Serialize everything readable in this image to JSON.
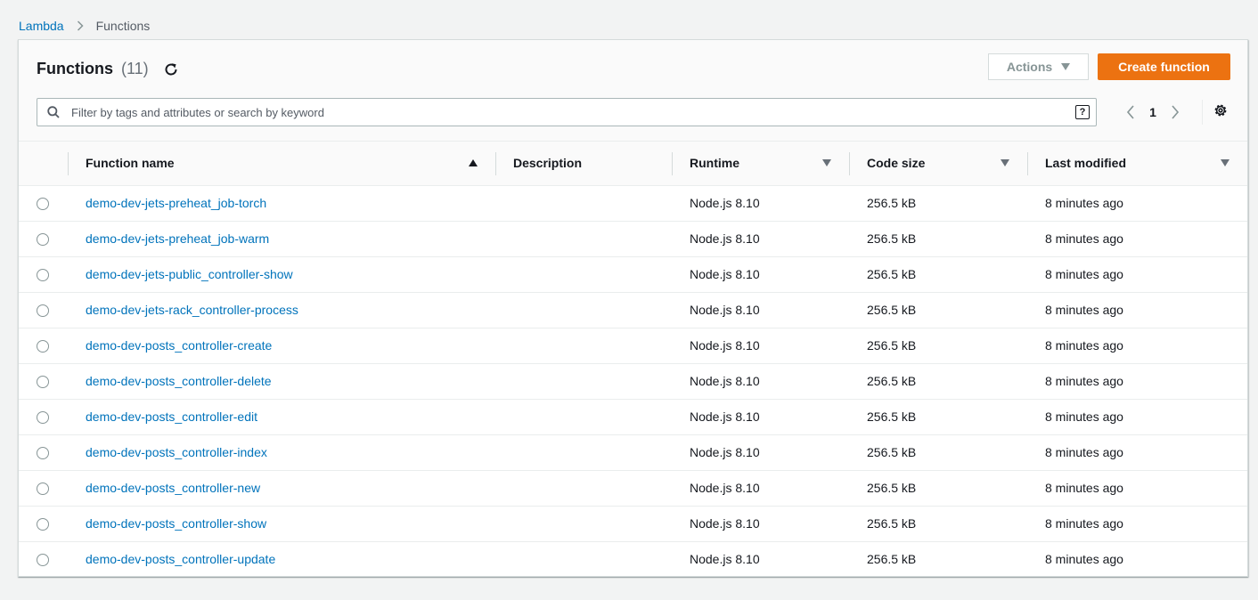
{
  "breadcrumb": {
    "root": "Lambda",
    "current": "Functions"
  },
  "header": {
    "title": "Functions",
    "count": "(11)",
    "actions_label": "Actions",
    "create_label": "Create function"
  },
  "search": {
    "placeholder": "Filter by tags and attributes or search by keyword",
    "help": "?"
  },
  "pagination": {
    "page": "1"
  },
  "table": {
    "columns": [
      "Function name",
      "Description",
      "Runtime",
      "Code size",
      "Last modified"
    ],
    "rows": [
      {
        "name": "demo-dev-jets-preheat_job-torch",
        "description": "",
        "runtime": "Node.js 8.10",
        "size": "256.5 kB",
        "modified": "8 minutes ago"
      },
      {
        "name": "demo-dev-jets-preheat_job-warm",
        "description": "",
        "runtime": "Node.js 8.10",
        "size": "256.5 kB",
        "modified": "8 minutes ago"
      },
      {
        "name": "demo-dev-jets-public_controller-show",
        "description": "",
        "runtime": "Node.js 8.10",
        "size": "256.5 kB",
        "modified": "8 minutes ago"
      },
      {
        "name": "demo-dev-jets-rack_controller-process",
        "description": "",
        "runtime": "Node.js 8.10",
        "size": "256.5 kB",
        "modified": "8 minutes ago"
      },
      {
        "name": "demo-dev-posts_controller-create",
        "description": "",
        "runtime": "Node.js 8.10",
        "size": "256.5 kB",
        "modified": "8 minutes ago"
      },
      {
        "name": "demo-dev-posts_controller-delete",
        "description": "",
        "runtime": "Node.js 8.10",
        "size": "256.5 kB",
        "modified": "8 minutes ago"
      },
      {
        "name": "demo-dev-posts_controller-edit",
        "description": "",
        "runtime": "Node.js 8.10",
        "size": "256.5 kB",
        "modified": "8 minutes ago"
      },
      {
        "name": "demo-dev-posts_controller-index",
        "description": "",
        "runtime": "Node.js 8.10",
        "size": "256.5 kB",
        "modified": "8 minutes ago"
      },
      {
        "name": "demo-dev-posts_controller-new",
        "description": "",
        "runtime": "Node.js 8.10",
        "size": "256.5 kB",
        "modified": "8 minutes ago"
      },
      {
        "name": "demo-dev-posts_controller-show",
        "description": "",
        "runtime": "Node.js 8.10",
        "size": "256.5 kB",
        "modified": "8 minutes ago"
      },
      {
        "name": "demo-dev-posts_controller-update",
        "description": "",
        "runtime": "Node.js 8.10",
        "size": "256.5 kB",
        "modified": "8 minutes ago"
      }
    ]
  },
  "colors": {
    "link": "#0073bb",
    "primary_button": "#ec7211",
    "background": "#f2f3f3"
  },
  "icons": {
    "refresh": "refresh-icon",
    "search": "search-icon",
    "settings": "gear-icon",
    "prev": "chevron-left-icon",
    "next": "chevron-right-icon"
  }
}
